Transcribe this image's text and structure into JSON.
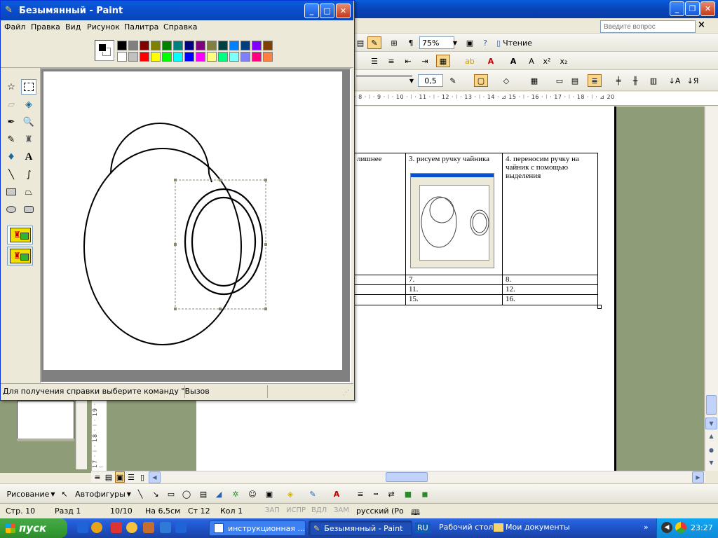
{
  "word": {
    "ask_placeholder": "Введите вопрос",
    "zoom": "75%",
    "reading_label": "Чтение",
    "line_weight": "0,5",
    "ruler_text": "· 8 · ⁝ · 9 · ⁝ · 10 · ⁝ · 11 · ⁝ · 12 · ⁝ · 13 · ⁝ · 14 · ⊿ 15 · ⁝ · 16 · ⁝ · 17 · ⁝ · 18 · ⁝ · ⊿ 20",
    "vruler_text": "17 · ⁝ · 18 · ⁝ · 19 · ⁝",
    "table": {
      "header_cells": [
        "лишнее",
        "3.   рисуем ручку чайника",
        "4.   переносим ручку на чайник с помощью выделения"
      ],
      "rows": [
        [
          "",
          "7.",
          "8."
        ],
        [
          "",
          "11.",
          "12."
        ],
        [
          "",
          "15.",
          "16."
        ]
      ]
    },
    "drawing_toolbar": {
      "draw_label": "Рисование",
      "autoshapes_label": "Автофигуры"
    },
    "status": {
      "page": "Стр. 10",
      "section": "Разд 1",
      "pages": "10/10",
      "at": "На 6,5см",
      "line": "Ст 12",
      "col": "Кол 1",
      "rec": "ЗАП",
      "trk": "ИСПР",
      "ext": "ВДЛ",
      "ovr": "ЗАМ",
      "lang": "русский (Ро"
    }
  },
  "paint": {
    "title": "Безымянный - Paint",
    "menus": [
      "Файл",
      "Правка",
      "Вид",
      "Рисунок",
      "Палитра",
      "Справка"
    ],
    "status_text": "Для получения справки выберите команду \"Вызов",
    "palette_top": [
      "#000000",
      "#808080",
      "#800000",
      "#808000",
      "#008000",
      "#008080",
      "#000080",
      "#800080",
      "#808040",
      "#004040",
      "#0080ff",
      "#004080",
      "#8000ff",
      "#804000"
    ],
    "palette_bottom": [
      "#ffffff",
      "#c0c0c0",
      "#ff0000",
      "#ffff00",
      "#00ff00",
      "#00ffff",
      "#0000ff",
      "#ff00ff",
      "#ffff80",
      "#00ff80",
      "#80ffff",
      "#8080ff",
      "#ff0080",
      "#ff8040"
    ],
    "tools": [
      "free-select",
      "rect-select",
      "eraser",
      "fill",
      "color-picker",
      "magnifier",
      "pencil",
      "brush",
      "airbrush",
      "text",
      "line",
      "curve",
      "rectangle",
      "polygon",
      "ellipse",
      "rounded-rectangle"
    ]
  },
  "taskbar": {
    "start_label": "пуск",
    "tasks": [
      "инструкционная ...",
      "Безымянный - Paint"
    ],
    "lang": "RU",
    "desktop_label": "Рабочий стол",
    "mydocs_label": "Мои документы",
    "time": "23:27"
  }
}
